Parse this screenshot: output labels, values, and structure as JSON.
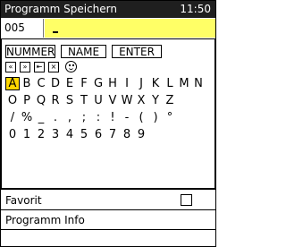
{
  "titlebar": {
    "title": "Programm Speichern",
    "clock": "11:50"
  },
  "namebar": {
    "number": "005",
    "value": ""
  },
  "keyboard": {
    "modes": [
      "NUMMER",
      "NAME",
      "ENTER"
    ],
    "controls": [
      "«",
      "»",
      "⇤",
      "×"
    ],
    "rows": [
      [
        "A",
        "B",
        "C",
        "D",
        "E",
        "F",
        "G",
        "H",
        "I",
        "J",
        "K",
        "L",
        "M",
        "N"
      ],
      [
        "O",
        "P",
        "Q",
        "R",
        "S",
        "T",
        "U",
        "V",
        "W",
        "X",
        "Y",
        "Z"
      ],
      [
        "/",
        "%",
        "_",
        ".",
        ",",
        ";",
        ":",
        "!",
        "-",
        "(",
        ")",
        "°"
      ],
      [
        "0",
        "1",
        "2",
        "3",
        "4",
        "5",
        "6",
        "7",
        "8",
        "9"
      ]
    ],
    "selected": "A"
  },
  "menu": {
    "favorit": "Favorit",
    "info": "Programm Info"
  }
}
